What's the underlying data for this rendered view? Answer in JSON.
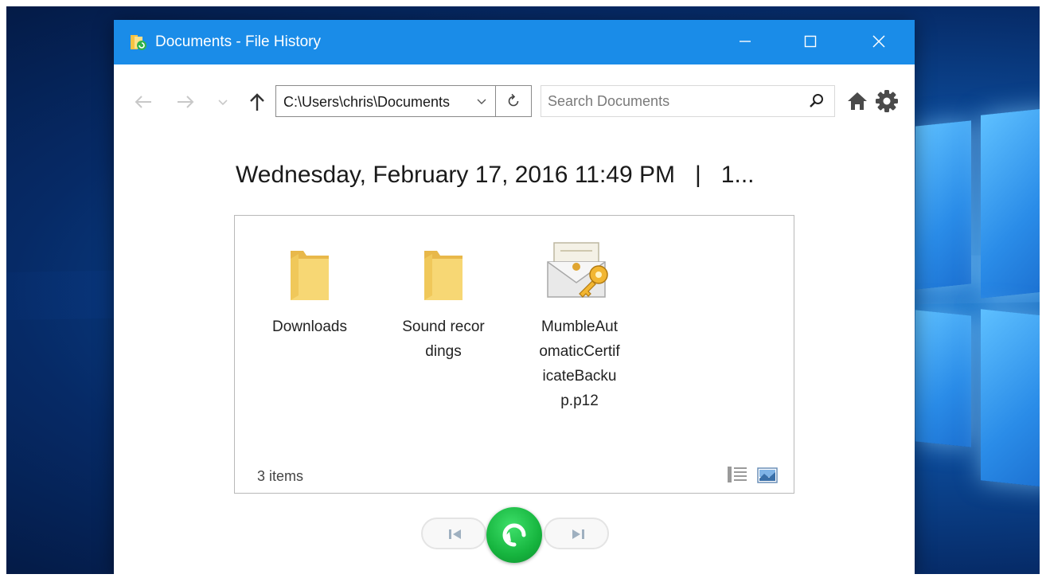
{
  "window": {
    "title": "Documents - File History"
  },
  "toolbar": {
    "address_path": "C:\\Users\\chris\\Documents",
    "search_placeholder": "Search Documents"
  },
  "snapshot": {
    "heading": "Wednesday, February 17, 2016 11:49 PM   |   1..."
  },
  "files": [
    {
      "name": "Downloads",
      "type": "folder"
    },
    {
      "name": "Sound recordings",
      "type": "folder"
    },
    {
      "name": "MumbleAutomaticCertificateBackup.p12",
      "type": "certificate"
    }
  ],
  "status": {
    "item_count": "3 items"
  },
  "colors": {
    "titlebar": "#1a8ce8",
    "restore_button": "#16b43e",
    "folder": "#f7d774"
  },
  "icons": {
    "back": "arrow-left-icon",
    "forward": "arrow-right-icon",
    "recent": "chevron-down-icon",
    "up": "arrow-up-icon",
    "refresh": "refresh-icon",
    "search": "search-icon",
    "home": "home-icon",
    "settings": "gear-icon",
    "previous": "previous-version-icon",
    "restore": "restore-icon",
    "next": "next-version-icon"
  }
}
